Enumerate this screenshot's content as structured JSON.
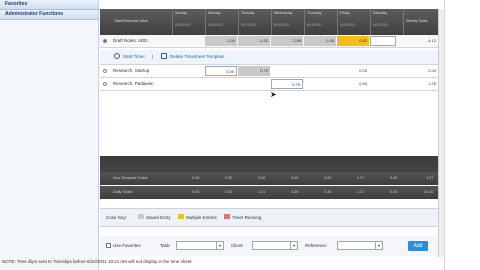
{
  "sidebar": {
    "items": [
      {
        "label": "Favorites"
      },
      {
        "label": "Administrator Functions"
      }
    ]
  },
  "grid": {
    "header_first": "Task/Reference Value",
    "days": [
      {
        "day": "Sunday",
        "date": "8/15/2011"
      },
      {
        "day": "Monday",
        "date": "8/16/2011"
      },
      {
        "day": "Tuesday",
        "date": "8/17/2011"
      },
      {
        "day": "Wednesday",
        "date": "8/18/2011"
      },
      {
        "day": "Thursday",
        "date": "8/19/2011"
      },
      {
        "day": "Friday",
        "date": "8/20/2011"
      },
      {
        "day": "Saturday",
        "date": "8/21/2011"
      }
    ],
    "header_last": "Weekly Totals",
    "rows": [
      {
        "name": "Draft Notes: ADD",
        "values": [
          "",
          "1.00",
          "0.32",
          "2.89",
          "0.35",
          "0.62",
          ""
        ],
        "total": "4.12"
      },
      {
        "name": "Research, Startup",
        "values": [
          "",
          "1.00",
          "0.79",
          "",
          "",
          "0.25",
          ""
        ],
        "total": "2.04"
      },
      {
        "name": "Research, Padawan",
        "values": [
          "",
          "",
          "",
          "0.75",
          "",
          "0.50",
          ""
        ],
        "total": "1.25"
      }
    ],
    "timer_links": {
      "start": "Start Timer",
      "sep": "|",
      "delete": "Delete Timesheet Template"
    },
    "totals": [
      {
        "label": "Non-Template Totals",
        "values": [
          "0.00",
          "0.00",
          "0.00",
          "0.00",
          "0.00",
          "1.37",
          "0.00"
        ],
        "total": "1.37"
      },
      {
        "label": "Daily Totals",
        "values": [
          "0.00",
          "2.00",
          "1.21",
          "3.39",
          "0.35",
          "1.37",
          "0.00"
        ],
        "total": "11.00"
      }
    ]
  },
  "legend": {
    "title": "Color Key:",
    "items": [
      {
        "label": "Saved Entry",
        "color": "#c9c9c9"
      },
      {
        "label": "Multiple Entries",
        "color": "#f2bf1a"
      },
      {
        "label": "Timer Running",
        "color": "#e87070"
      }
    ]
  },
  "filter": {
    "favorites_label": "Use Favorites",
    "task_label": "Task:",
    "client_label": "Client:",
    "reference_label": "Reference:",
    "add_label": "Add"
  },
  "note": "NOTE: Time slips sent to Timeslips before 8/22/2011 10:41 AM will not display in the time sheet."
}
